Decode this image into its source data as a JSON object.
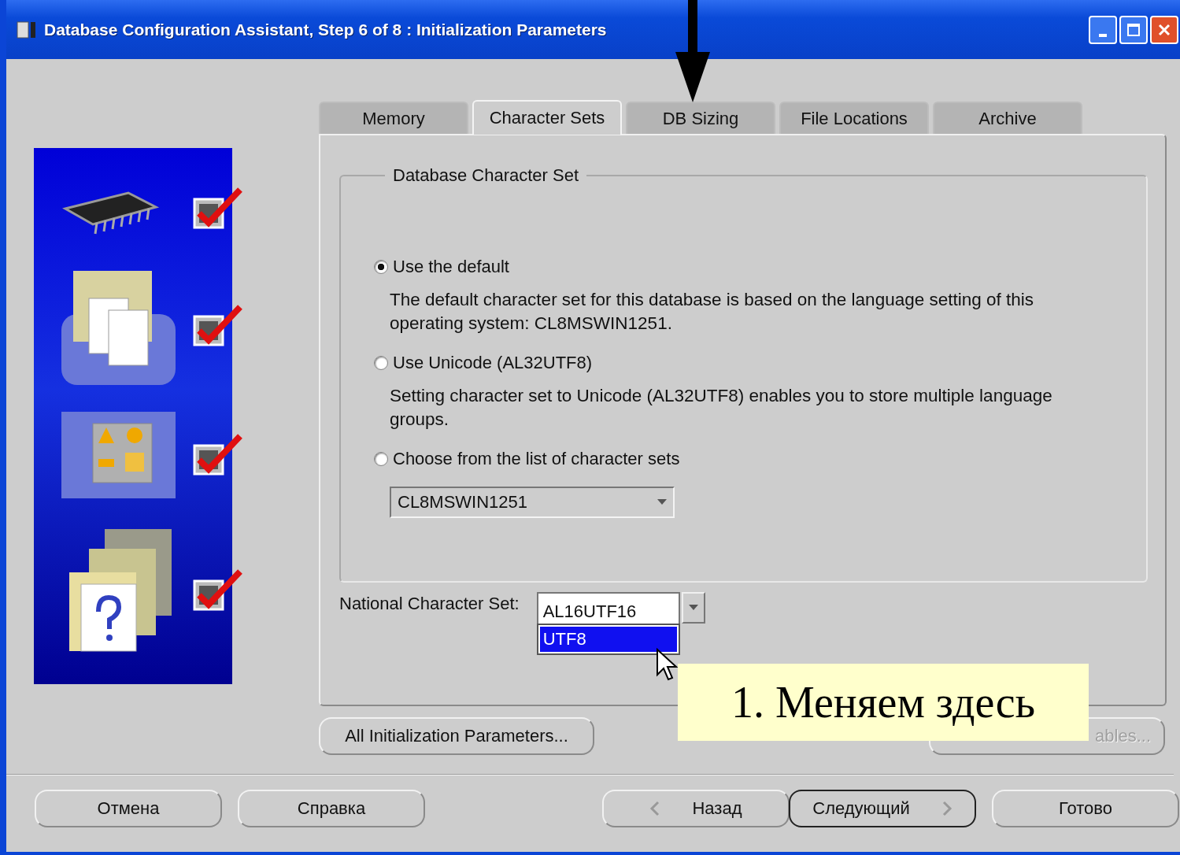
{
  "window": {
    "title": "Database Configuration Assistant, Step 6 of 8 : Initialization Parameters"
  },
  "wizard_steps": [
    {
      "kind": "memory",
      "checked": true
    },
    {
      "kind": "documents",
      "checked": true
    },
    {
      "kind": "shapes",
      "checked": true
    },
    {
      "kind": "folders",
      "checked": true
    }
  ],
  "tabs": [
    {
      "label": "Memory",
      "selected": false
    },
    {
      "label": "Character Sets",
      "selected": true
    },
    {
      "label": "DB Sizing",
      "selected": false
    },
    {
      "label": "File Locations",
      "selected": false
    },
    {
      "label": "Archive",
      "selected": false
    }
  ],
  "database_character_set": {
    "title": "Database Character Set",
    "options": [
      {
        "label": "Use the default",
        "description": "The default character set for this database is based on the language setting of this operating system: CL8MSWIN1251.",
        "selected": true
      },
      {
        "label": "Use Unicode (AL32UTF8)",
        "description": "Setting character set to Unicode (AL32UTF8) enables you to store multiple language groups.",
        "selected": false
      },
      {
        "label": "Choose from the list of character sets",
        "selected": false
      }
    ],
    "dropdown": {
      "value": "CL8MSWIN1251"
    }
  },
  "national_character_set": {
    "label": "National Character Set:",
    "value": "AL16UTF16",
    "list": [
      {
        "label": "UTF8",
        "selected": true
      }
    ]
  },
  "action_buttons": [
    {
      "label": "All Initialization Parameters...",
      "disabled": false
    },
    {
      "label": "ables...",
      "disabled": true
    }
  ],
  "nav_buttons": [
    {
      "label": "Отмена",
      "kind": "plain",
      "default": false
    },
    {
      "label": "Справка",
      "kind": "plain",
      "default": false
    },
    {
      "label": "Назад",
      "kind": "back",
      "default": false
    },
    {
      "label": "Следующий",
      "kind": "next",
      "default": true
    },
    {
      "label": "Готово",
      "kind": "plain",
      "default": false
    }
  ],
  "callout": {
    "text": "1. Меняем здесь"
  }
}
